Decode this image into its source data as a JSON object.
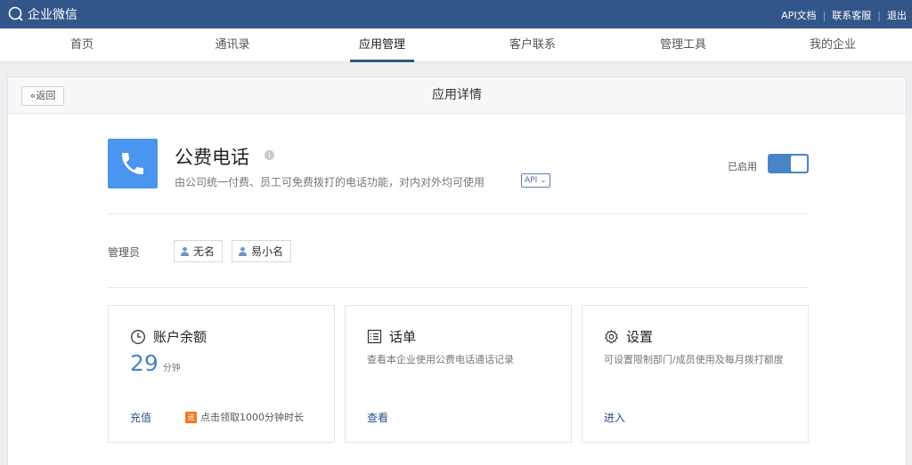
{
  "topbar": {
    "logo_text": "企业微信",
    "links": [
      "API文档",
      "联系客服",
      "退出"
    ]
  },
  "nav": {
    "items": [
      "首页",
      "通讯录",
      "应用管理",
      "客户联系",
      "管理工具",
      "我的企业"
    ],
    "active": "应用管理"
  },
  "subheader": {
    "back_label": "«返回",
    "title": "应用详情"
  },
  "app": {
    "name": "公费电话",
    "description": "由公司统一付费、员工可免费拨打的电话功能，对内对外均可使用",
    "api_tag": "API ⌄",
    "status_label": "已启用",
    "enabled": true,
    "accent_color": "#4a95f0"
  },
  "admins": {
    "label": "管理员",
    "members": [
      "无名",
      "易小名"
    ]
  },
  "cards": {
    "balance": {
      "title": "账户余额",
      "amount": "29",
      "unit": "分钟",
      "link": "充值",
      "promo_badge": "送",
      "promo_text": "点击领取1000分钟时长"
    },
    "records": {
      "title": "话单",
      "description": "查看本企业使用公费电话通话记录",
      "link": "查看"
    },
    "settings": {
      "title": "设置",
      "description": "可设置限制部门/成员使用及每月拨打额度",
      "link": "进入"
    }
  }
}
